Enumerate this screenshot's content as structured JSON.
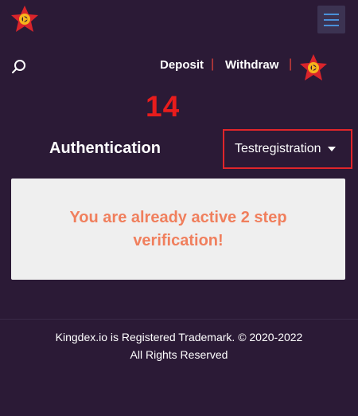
{
  "header": {
    "logo_icon": "kingdex-star-logo-icon",
    "menu_icon": "hamburger-menu-icon"
  },
  "nav": {
    "search_icon": "search-icon",
    "deposit_label": "Deposit",
    "separator": "|",
    "withdraw_label": "Withdraw",
    "logo_icon": "kingdex-star-logo-icon"
  },
  "annotation": {
    "number": "14"
  },
  "auth": {
    "title": "Authentication",
    "user_name": "Testregistration"
  },
  "notice": {
    "message": "You are already active 2 step verification!"
  },
  "footer": {
    "line1": "Kingdex.io is Registered Trademark. © 2020-2022",
    "line2": "All Rights Reserved"
  },
  "colors": {
    "background": "#2b1a36",
    "notice_text": "#f07f5d",
    "accent_red": "#e0252a",
    "menu_lines": "#4a90d9"
  }
}
